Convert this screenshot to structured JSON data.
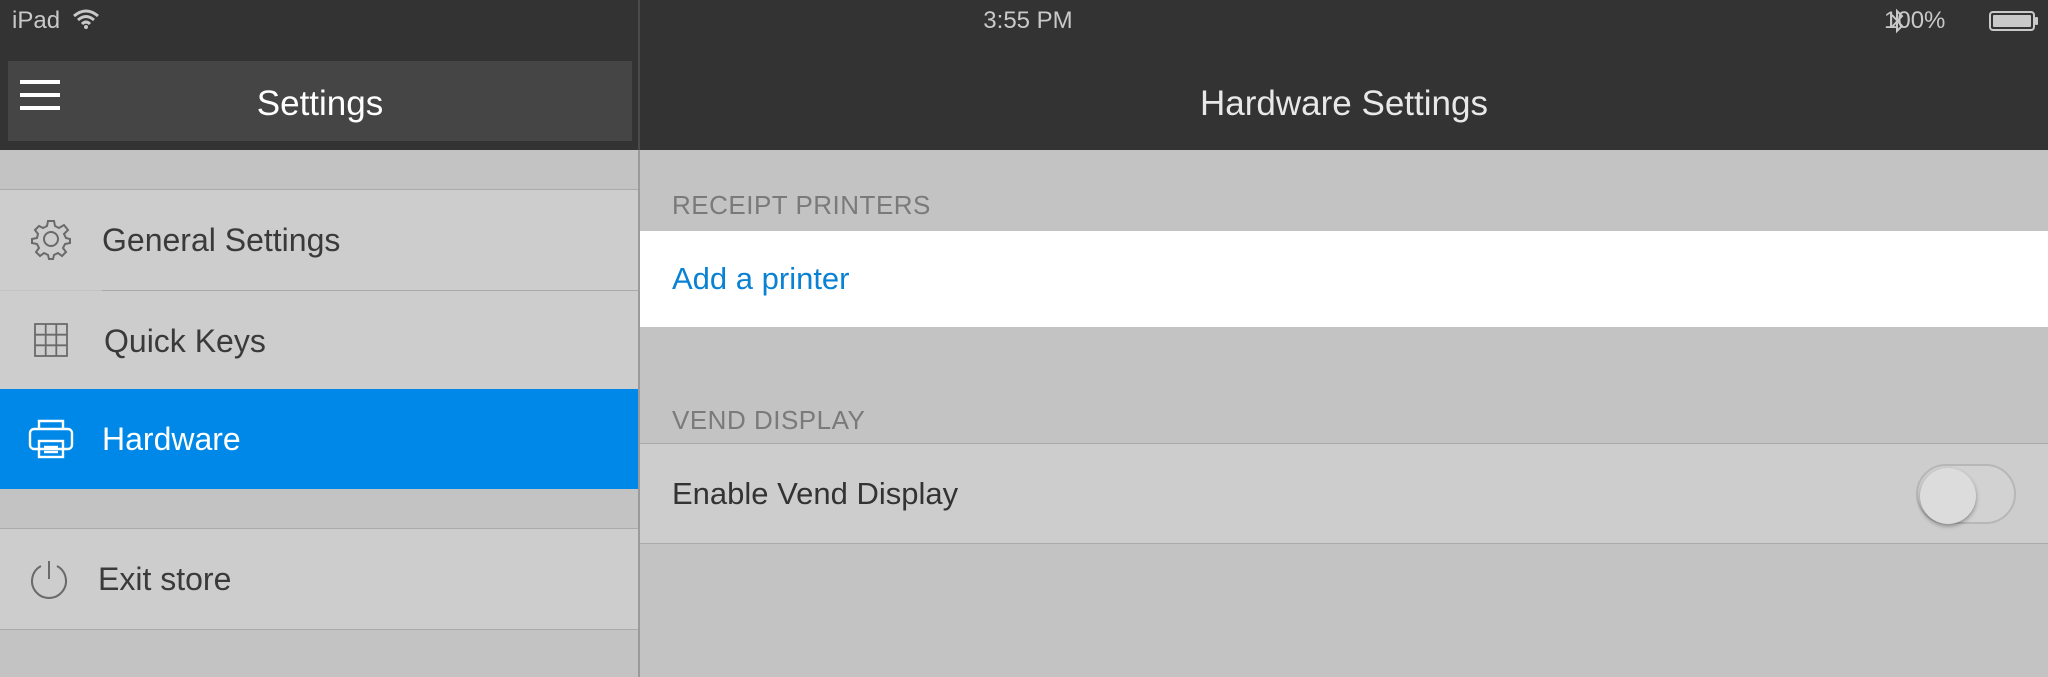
{
  "status_bar": {
    "carrier": "iPad",
    "time": "3:55 PM",
    "battery": "100%",
    "icons": [
      "wifi-icon",
      "bluetooth-icon",
      "battery-icon"
    ]
  },
  "header": {
    "sidebar_title": "Settings",
    "page_title": "Hardware Settings",
    "menu_icon": "hamburger-menu-icon"
  },
  "sidebar": {
    "items": [
      {
        "label": "General Settings",
        "icon": "gear-icon",
        "selected": false
      },
      {
        "label": "Quick Keys",
        "icon": "grid-icon",
        "selected": false
      },
      {
        "label": "Hardware",
        "icon": "printer-icon",
        "selected": true
      },
      {
        "label": "Exit store",
        "icon": "power-icon",
        "selected": false
      }
    ]
  },
  "main": {
    "receipt_printers": {
      "header": "RECEIPT PRINTERS",
      "add_label": "Add a printer"
    },
    "vend_display": {
      "header": "VEND DISPLAY",
      "toggle_label": "Enable Vend Display",
      "enabled": false
    }
  },
  "colors": {
    "accent": "#0088e8",
    "link": "#0a82d3",
    "header_bg": "#333333",
    "background": "#c3c3c3"
  }
}
